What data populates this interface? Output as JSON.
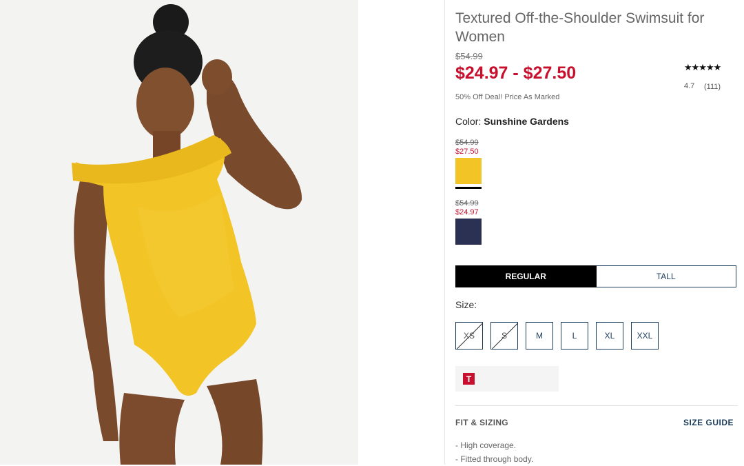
{
  "product": {
    "title": "Textured Off-the-Shoulder Swimsuit for Women",
    "original_price": "$54.99",
    "sale_price": "$24.97 - $27.50",
    "promo_text": "50% Off Deal! Price As Marked"
  },
  "rating": {
    "stars": "★★★★★",
    "value": "4.7",
    "count": "(111)"
  },
  "color": {
    "label": "Color:",
    "selected_name": "Sunshine Gardens",
    "swatches": [
      {
        "original": "$54.99",
        "sale": "$27.50",
        "hex": "#f2c425",
        "selected": true
      },
      {
        "original": "$54.99",
        "sale": "$24.97",
        "hex": "#2b3152",
        "selected": false
      }
    ]
  },
  "fit": {
    "options": [
      "REGULAR",
      "TALL"
    ],
    "selected": "REGULAR"
  },
  "size": {
    "label": "Size:",
    "options": [
      {
        "label": "XS",
        "available": false
      },
      {
        "label": "S",
        "available": false
      },
      {
        "label": "M",
        "available": true
      },
      {
        "label": "L",
        "available": true
      },
      {
        "label": "XL",
        "available": true
      },
      {
        "label": "XXL",
        "available": true
      }
    ]
  },
  "promo_badge": {
    "letter": "T"
  },
  "fit_sizing": {
    "heading": "FIT & SIZING",
    "size_guide": "SIZE GUIDE",
    "bullets": [
      "- High coverage.",
      "- Fitted through body."
    ]
  },
  "colors": {
    "sale_red": "#c8102e",
    "navy": "#1a3a5a",
    "swimsuit_yellow": "#f2c425"
  }
}
